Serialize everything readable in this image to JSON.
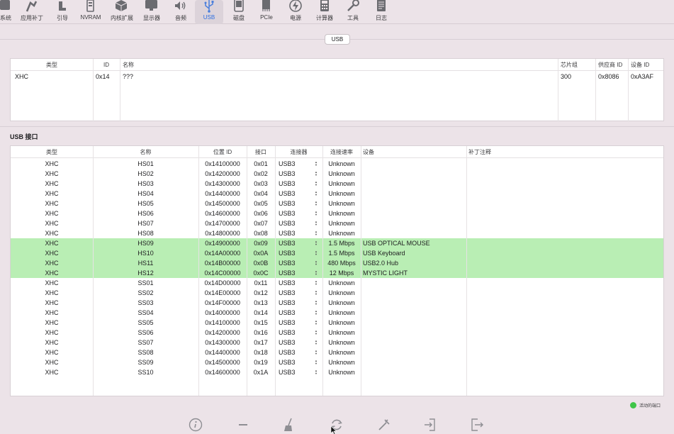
{
  "toolbar": {
    "items": [
      {
        "label": "系统",
        "icon": "system-icon"
      },
      {
        "label": "应用补丁",
        "icon": "patch-icon"
      },
      {
        "label": "引导",
        "icon": "boot-icon"
      },
      {
        "label": "NVRAM",
        "icon": "nvram-icon"
      },
      {
        "label": "内核扩展",
        "icon": "kext-icon"
      },
      {
        "label": "显示器",
        "icon": "display-icon"
      },
      {
        "label": "音频",
        "icon": "audio-icon"
      },
      {
        "label": "USB",
        "icon": "usb-icon",
        "active": true
      },
      {
        "label": "磁盘",
        "icon": "disk-icon"
      },
      {
        "label": "PCIe",
        "icon": "pcie-icon"
      },
      {
        "label": "电源",
        "icon": "power-icon"
      },
      {
        "label": "计算器",
        "icon": "calculator-icon"
      },
      {
        "label": "工具",
        "icon": "tools-icon"
      },
      {
        "label": "日志",
        "icon": "log-icon"
      }
    ]
  },
  "page_title": "USB",
  "controllers": {
    "columns": [
      "类型",
      "ID",
      "名称",
      "芯片组",
      "供应商 ID",
      "设备 ID"
    ],
    "rows": [
      {
        "type": "XHC",
        "id": "0x14",
        "name": "???",
        "chipset": "300",
        "vendor_id": "0x8086",
        "device_id": "0xA3AF"
      }
    ]
  },
  "ports_section_title": "USB 接口",
  "ports": {
    "columns": [
      "类型",
      "名称",
      "位置 ID",
      "接口",
      "连接器",
      "连接速率",
      "设备",
      "补丁注释"
    ],
    "rows": [
      {
        "type": "XHC",
        "name": "HS01",
        "location": "0x14100000",
        "port": "0x01",
        "connector": "USB3",
        "speed": "Unknown",
        "device": "",
        "comment": "",
        "active": false
      },
      {
        "type": "XHC",
        "name": "HS02",
        "location": "0x14200000",
        "port": "0x02",
        "connector": "USB3",
        "speed": "Unknown",
        "device": "",
        "comment": "",
        "active": false
      },
      {
        "type": "XHC",
        "name": "HS03",
        "location": "0x14300000",
        "port": "0x03",
        "connector": "USB3",
        "speed": "Unknown",
        "device": "",
        "comment": "",
        "active": false
      },
      {
        "type": "XHC",
        "name": "HS04",
        "location": "0x14400000",
        "port": "0x04",
        "connector": "USB3",
        "speed": "Unknown",
        "device": "",
        "comment": "",
        "active": false
      },
      {
        "type": "XHC",
        "name": "HS05",
        "location": "0x14500000",
        "port": "0x05",
        "connector": "USB3",
        "speed": "Unknown",
        "device": "",
        "comment": "",
        "active": false
      },
      {
        "type": "XHC",
        "name": "HS06",
        "location": "0x14600000",
        "port": "0x06",
        "connector": "USB3",
        "speed": "Unknown",
        "device": "",
        "comment": "",
        "active": false
      },
      {
        "type": "XHC",
        "name": "HS07",
        "location": "0x14700000",
        "port": "0x07",
        "connector": "USB3",
        "speed": "Unknown",
        "device": "",
        "comment": "",
        "active": false
      },
      {
        "type": "XHC",
        "name": "HS08",
        "location": "0x14800000",
        "port": "0x08",
        "connector": "USB3",
        "speed": "Unknown",
        "device": "",
        "comment": "",
        "active": false
      },
      {
        "type": "XHC",
        "name": "HS09",
        "location": "0x14900000",
        "port": "0x09",
        "connector": "USB3",
        "speed": "1.5 Mbps",
        "device": "USB OPTICAL MOUSE",
        "comment": "",
        "active": true
      },
      {
        "type": "XHC",
        "name": "HS10",
        "location": "0x14A00000",
        "port": "0x0A",
        "connector": "USB3",
        "speed": "1.5 Mbps",
        "device": "USB Keyboard",
        "comment": "",
        "active": true
      },
      {
        "type": "XHC",
        "name": "HS11",
        "location": "0x14B00000",
        "port": "0x0B",
        "connector": "USB3",
        "speed": "480 Mbps",
        "device": "USB2.0 Hub",
        "comment": "",
        "active": true
      },
      {
        "type": "XHC",
        "name": "HS12",
        "location": "0x14C00000",
        "port": "0x0C",
        "connector": "USB3",
        "speed": "12 Mbps",
        "device": "MYSTIC LIGHT",
        "comment": "",
        "active": true
      },
      {
        "type": "XHC",
        "name": "SS01",
        "location": "0x14D00000",
        "port": "0x11",
        "connector": "USB3",
        "speed": "Unknown",
        "device": "",
        "comment": "",
        "active": false
      },
      {
        "type": "XHC",
        "name": "SS02",
        "location": "0x14E00000",
        "port": "0x12",
        "connector": "USB3",
        "speed": "Unknown",
        "device": "",
        "comment": "",
        "active": false
      },
      {
        "type": "XHC",
        "name": "SS03",
        "location": "0x14F00000",
        "port": "0x13",
        "connector": "USB3",
        "speed": "Unknown",
        "device": "",
        "comment": "",
        "active": false
      },
      {
        "type": "XHC",
        "name": "SS04",
        "location": "0x14000000",
        "port": "0x14",
        "connector": "USB3",
        "speed": "Unknown",
        "device": "",
        "comment": "",
        "active": false
      },
      {
        "type": "XHC",
        "name": "SS05",
        "location": "0x14100000",
        "port": "0x15",
        "connector": "USB3",
        "speed": "Unknown",
        "device": "",
        "comment": "",
        "active": false
      },
      {
        "type": "XHC",
        "name": "SS06",
        "location": "0x14200000",
        "port": "0x16",
        "connector": "USB3",
        "speed": "Unknown",
        "device": "",
        "comment": "",
        "active": false
      },
      {
        "type": "XHC",
        "name": "SS07",
        "location": "0x14300000",
        "port": "0x17",
        "connector": "USB3",
        "speed": "Unknown",
        "device": "",
        "comment": "",
        "active": false
      },
      {
        "type": "XHC",
        "name": "SS08",
        "location": "0x14400000",
        "port": "0x18",
        "connector": "USB3",
        "speed": "Unknown",
        "device": "",
        "comment": "",
        "active": false
      },
      {
        "type": "XHC",
        "name": "SS09",
        "location": "0x14500000",
        "port": "0x19",
        "connector": "USB3",
        "speed": "Unknown",
        "device": "",
        "comment": "",
        "active": false
      },
      {
        "type": "XHC",
        "name": "SS10",
        "location": "0x14600000",
        "port": "0x1A",
        "connector": "USB3",
        "speed": "Unknown",
        "device": "",
        "comment": "",
        "active": false
      }
    ]
  },
  "legend": {
    "label": "活动的端口",
    "color": "#3fc548"
  },
  "highlight_color": "#b9eeb4",
  "accent_color": "#2f6fe0",
  "bottom_buttons": [
    {
      "icon": "info-icon"
    },
    {
      "icon": "remove-icon"
    },
    {
      "icon": "clean-icon"
    },
    {
      "icon": "refresh-icon"
    },
    {
      "icon": "inject-icon"
    },
    {
      "icon": "import-icon"
    },
    {
      "icon": "export-icon"
    }
  ]
}
